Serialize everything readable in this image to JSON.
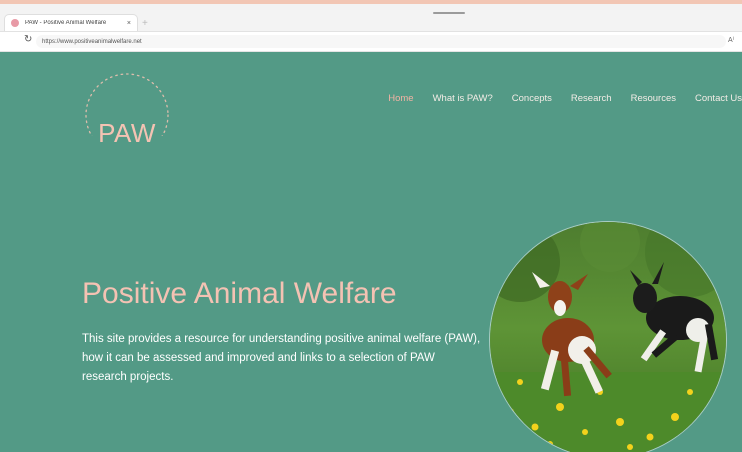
{
  "browser": {
    "tab_title": "PAW - Positive Animal Welfare",
    "tab_close": "×",
    "new_tab": "+",
    "url": "https://www.positiveanimalwelfare.net",
    "read_aloud": "A⁾",
    "reload_glyph": "↻"
  },
  "site": {
    "logo_text": "PAW",
    "nav": [
      {
        "label": "Home",
        "active": true
      },
      {
        "label": "What is PAW?"
      },
      {
        "label": "Concepts"
      },
      {
        "label": "Research"
      },
      {
        "label": "Resources"
      },
      {
        "label": "Contact Us"
      }
    ],
    "hero": {
      "title": "Positive Animal Welfare",
      "text": "This site provides a resource for understanding positive animal welfare (PAW), how it can be assessed and improved and links to a selection of PAW research projects."
    }
  },
  "icons": {
    "favicon": "paw-favicon-icon",
    "reload": "reload-icon",
    "read_aloud": "read-aloud-icon"
  },
  "colors": {
    "background": "#539a86",
    "accent": "#f4c2b3",
    "active_nav": "#f2b3a4"
  }
}
